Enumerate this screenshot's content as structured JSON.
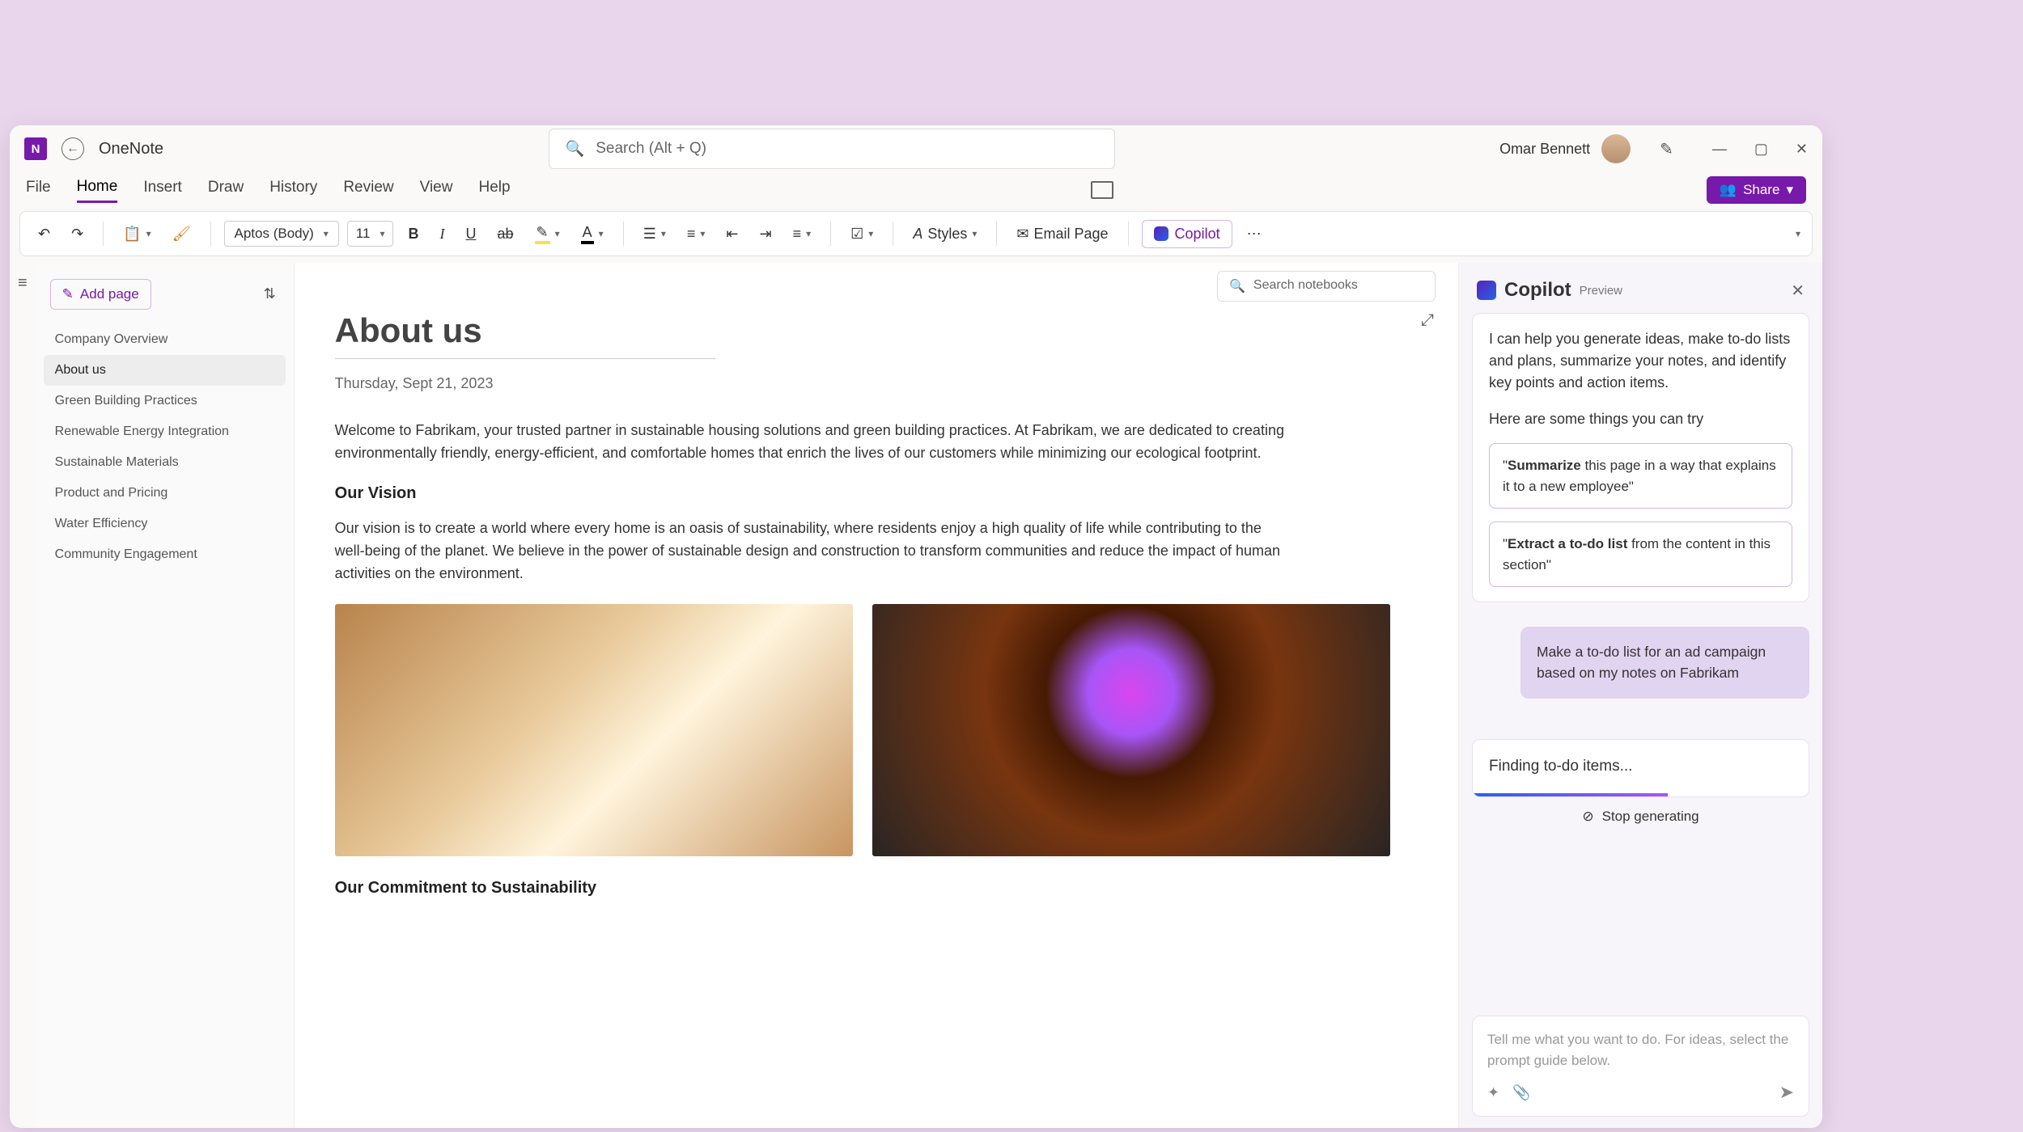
{
  "app": {
    "name": "OneNote"
  },
  "user": {
    "name": "Omar Bennett"
  },
  "search": {
    "placeholder": "Search (Alt + Q)"
  },
  "menus": [
    "File",
    "Home",
    "Insert",
    "Draw",
    "History",
    "Review",
    "View",
    "Help"
  ],
  "active_menu": 1,
  "share_label": "Share",
  "ribbon": {
    "font": "Aptos (Body)",
    "size": "11",
    "styles": "Styles",
    "email": "Email Page",
    "copilot": "Copilot"
  },
  "sidebar": {
    "add_page": "Add page",
    "search_nb": "Search notebooks",
    "pages": [
      "Company Overview",
      "About us",
      "Green Building Practices",
      "Renewable Energy Integration",
      "Sustainable Materials",
      "Product and Pricing",
      "Water Efficiency",
      "Community Engagement"
    ],
    "active_page": 1
  },
  "note": {
    "title": "About us",
    "date": "Thursday, Sept 21, 2023",
    "intro": "Welcome to Fabrikam, your trusted partner in sustainable housing solutions and green building practices. At Fabrikam, we are dedicated to creating environmentally friendly, energy-efficient, and comfortable homes that enrich the lives of our customers while minimizing our ecological footprint.",
    "h_vision": "Our Vision",
    "vision": "Our vision is to create a world where every home is an oasis of sustainability, where residents enjoy a high quality of life while contributing to the well-being of the planet. We believe in the power of sustainable design and construction to transform communities and reduce the impact of human activities on the environment.",
    "h_commit": "Our Commitment to Sustainability"
  },
  "copilot": {
    "title": "Copilot",
    "preview": "Preview",
    "intro1": "I can help you generate ideas, make to-do lists and plans, summarize your notes, and identify key points and action items.",
    "intro2": "Here are some things you can try",
    "s1_pre": "\"",
    "s1_bold": "Summarize",
    "s1_rest": " this page in a way that explains it to a new employee\"",
    "s2_pre": "\"",
    "s2_bold": "Extract a to-do list",
    "s2_rest": " from the content in this section\"",
    "user_msg": "Make a to-do list for an ad campaign based on my notes on Fabrikam",
    "progress": "Finding to-do items...",
    "stop": "Stop generating",
    "input_ph": "Tell me what you want to do. For ideas, select the prompt guide below."
  }
}
